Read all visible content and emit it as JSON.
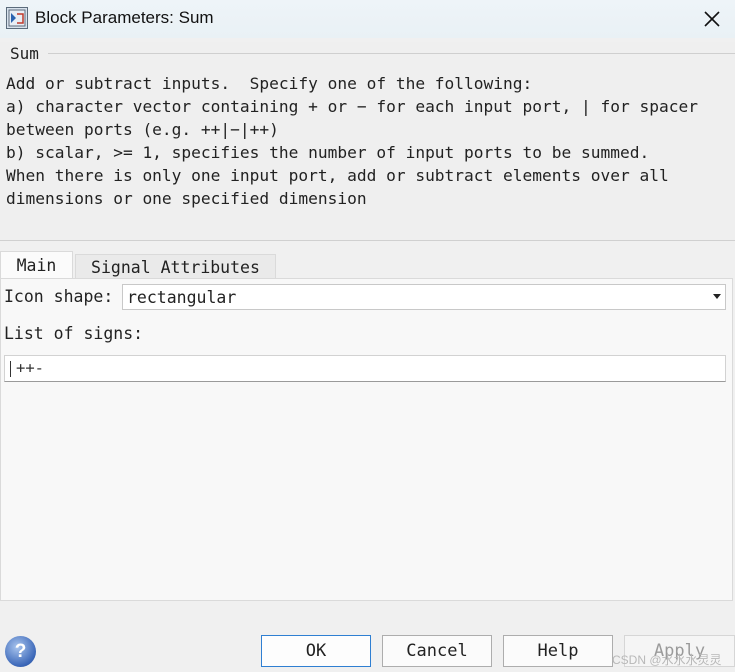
{
  "window": {
    "title": "Block Parameters: Sum",
    "app_icon": "simulink-block-icon",
    "close_icon": "close-icon"
  },
  "description": {
    "block_name": "Sum",
    "text": "Add or subtract inputs.  Specify one of the following:\na) character vector containing + or − for each input port, | for spacer\nbetween ports (e.g. ++|−|++)\nb) scalar, >= 1, specifies the number of input ports to be summed.\nWhen there is only one input port, add or subtract elements over all\ndimensions or one specified dimension"
  },
  "tabs": [
    {
      "label": "Main",
      "active": true
    },
    {
      "label": "Signal Attributes",
      "active": false
    }
  ],
  "main": {
    "icon_shape_label": "Icon shape:",
    "icon_shape_value": "rectangular",
    "signs_label": "List of signs:",
    "signs_value": "++-"
  },
  "buttons": {
    "ok": "OK",
    "cancel": "Cancel",
    "help": "Help",
    "apply": "Apply"
  },
  "help_icon_glyph": "?",
  "watermark": "CSDN @水水水灵灵",
  "colors": {
    "accent": "#2f7fd2",
    "background": "#f0f0f0"
  }
}
